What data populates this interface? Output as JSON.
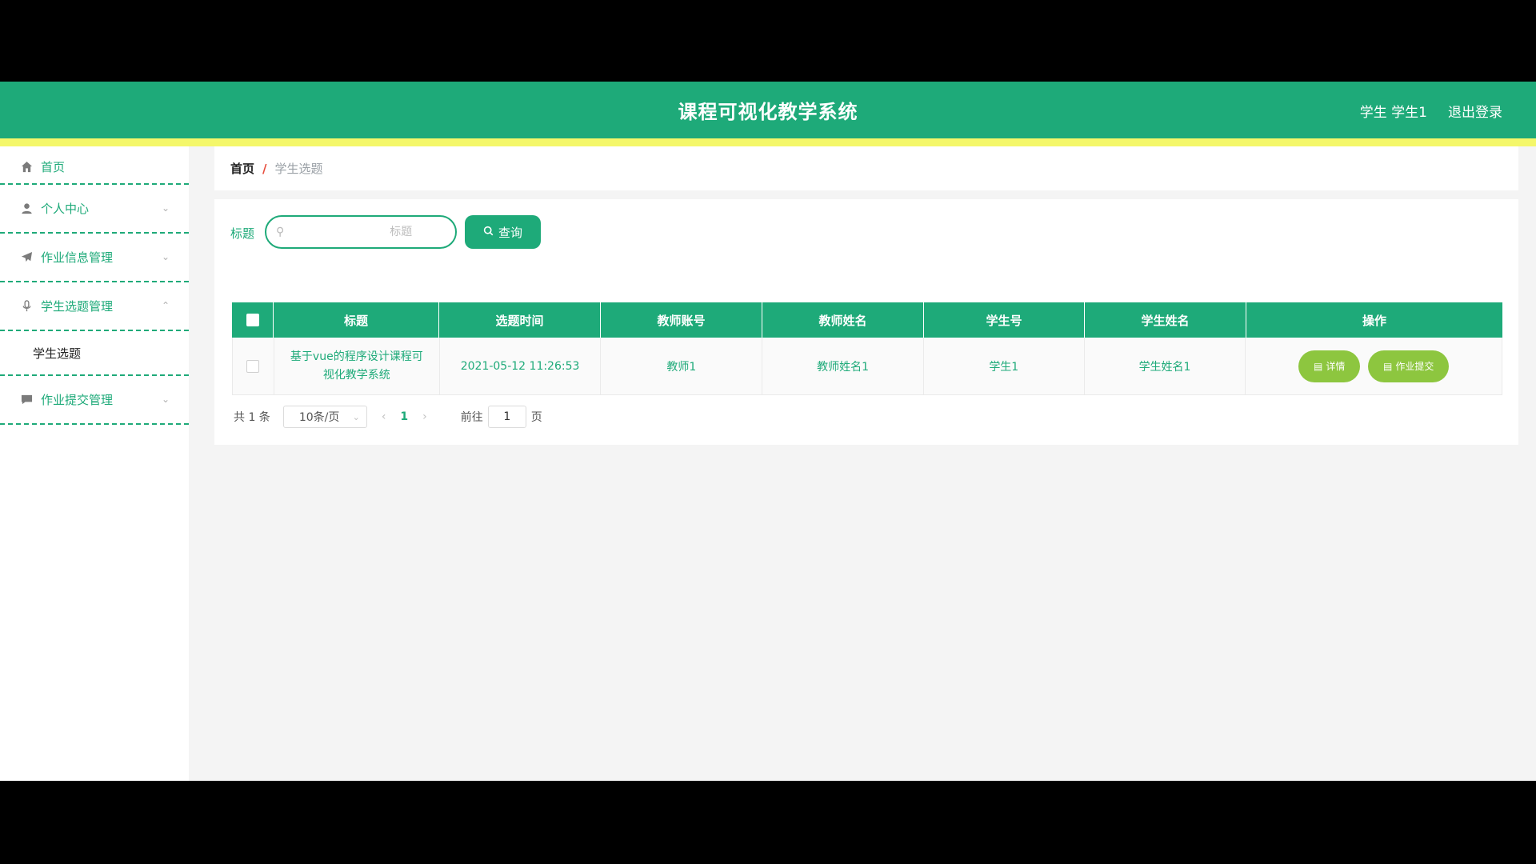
{
  "header": {
    "title": "课程可视化教学系统",
    "user_label": "学生 学生1",
    "logout_label": "退出登录"
  },
  "sidebar": {
    "items": [
      {
        "label": "首页",
        "icon": "home-icon"
      },
      {
        "label": "个人中心",
        "icon": "user-icon"
      },
      {
        "label": "作业信息管理",
        "icon": "paper-plane-icon"
      },
      {
        "label": "学生选题管理",
        "icon": "microphone-icon"
      },
      {
        "label": "作业提交管理",
        "icon": "chat-icon"
      }
    ],
    "submenu_label": "学生选题"
  },
  "breadcrumb": {
    "home": "首页",
    "separator": "/",
    "current": "学生选题"
  },
  "search": {
    "label": "标题",
    "placeholder": "标题",
    "button_label": "查询"
  },
  "table": {
    "columns": [
      "标题",
      "选题时间",
      "教师账号",
      "教师姓名",
      "学生号",
      "学生姓名",
      "操作"
    ],
    "rows": [
      {
        "title": "基于vue的程序设计课程可视化教学系统",
        "time": "2021-05-12 11:26:53",
        "teacher_account": "教师1",
        "teacher_name": "教师姓名1",
        "student_no": "学生1",
        "student_name": "学生姓名1",
        "detail_label": "详情",
        "submit_label": "作业提交"
      }
    ]
  },
  "pagination": {
    "total": "共 1 条",
    "page_size": "10条/页",
    "current_page": "1",
    "goto_label": "前往",
    "goto_value": "1",
    "page_suffix": "页"
  },
  "colors": {
    "primary": "#1eaa79",
    "accent_strip": "#f4f76a",
    "op_button": "#8dc63f"
  }
}
